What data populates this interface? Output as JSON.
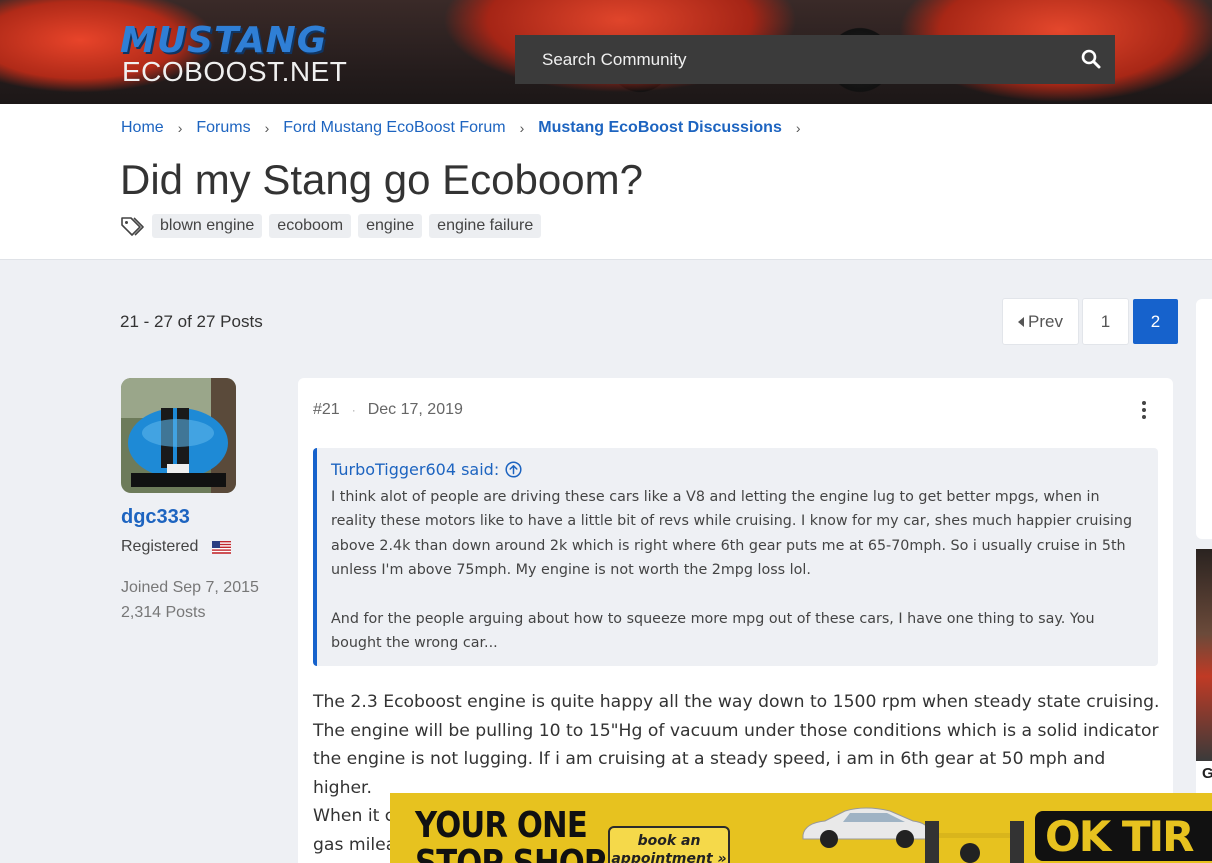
{
  "header": {
    "logo_line1": "MUSTANG",
    "logo_line2": "ECOBOOST.NET",
    "search_placeholder": "Search Community"
  },
  "breadcrumbs": [
    "Home",
    "Forums",
    "Ford Mustang EcoBoost Forum",
    "Mustang EcoBoost Discussions"
  ],
  "thread": {
    "title": "Did my Stang go Ecoboom?",
    "tags": [
      "blown engine",
      "ecoboom",
      "engine",
      "engine failure"
    ]
  },
  "pagination": {
    "summary": "21 - 27 of 27 Posts",
    "prev_label": "Prev",
    "pages": [
      "1",
      "2"
    ],
    "current_page": "2"
  },
  "post": {
    "user": {
      "name": "dgc333",
      "role": "Registered",
      "joined": "Joined Sep 7, 2015",
      "posts": "2,314 Posts"
    },
    "number": "#21",
    "date": "Dec 17, 2019",
    "quote": {
      "author_said": "TurboTigger604 said:",
      "paragraph1": "I think alot of people are driving these cars like a V8 and letting the engine lug to get better mpgs, when in reality these motors like to have a little bit of revs while cruising. I know for my car, shes much happier cruising above 2.4k than down around 2k which is right where 6th gear puts me at 65-70mph. So i usually cruise in 5th unless I'm above 75mph. My engine is not worth the 2mpg loss lol.",
      "paragraph2": "And for the people arguing about how to squeeze more mpg out of these cars, I have one thing to say. You bought the wrong car..."
    },
    "body_paragraph1": "The 2.3 Ecoboost engine is quite happy all the way down to 1500 rpm when steady state cruising. The engine will be pulling 10 to 15\"Hg of vacuum under those conditions which is a solid indicator the engine is not lugging. If i am cruising at a steady speed, i am in 6th gear at 50 mph and higher.",
    "body_paragraph2_visible": "When it c",
    "body_paragraph2_line2_visible": "gas milea"
  },
  "side_panel_text": "G",
  "ad": {
    "headline_line1": "YOUR ONE",
    "headline_line2": "STOP SHOP",
    "cta": "book an appointment »",
    "brand": "OK TIR"
  },
  "colors": {
    "accent": "#1662cc",
    "link": "#1d64c0",
    "ad_yellow": "#e7c21f"
  }
}
